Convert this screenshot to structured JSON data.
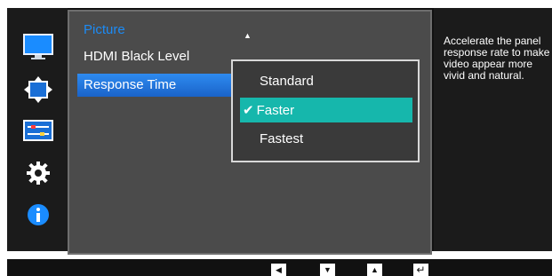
{
  "menu": {
    "title": "Picture",
    "scroll_up": "▲",
    "items": [
      {
        "label": "HDMI Black Level"
      },
      {
        "label": "Response Time",
        "selected": true
      }
    ]
  },
  "submenu": {
    "options": [
      {
        "label": "Standard"
      },
      {
        "label": "Faster",
        "checked": true
      },
      {
        "label": "Fastest"
      }
    ],
    "checkmark": "✔",
    "highlight_color": "#16b7ac"
  },
  "description": "Accelerate the panel response rate to make video appear more vivid and natural.",
  "side_icons": [
    "monitor-icon",
    "resize-arrows-icon",
    "settings-panel-icon",
    "gear-icon",
    "info-icon"
  ],
  "nav_buttons": [
    {
      "name": "left-button",
      "glyph": "◀"
    },
    {
      "name": "down-button",
      "glyph": "▼"
    },
    {
      "name": "up-button",
      "glyph": "▲"
    },
    {
      "name": "enter-button",
      "glyph": "↵"
    }
  ],
  "colors": {
    "accent": "#1c8bf5",
    "selection": "#1a63c9"
  }
}
